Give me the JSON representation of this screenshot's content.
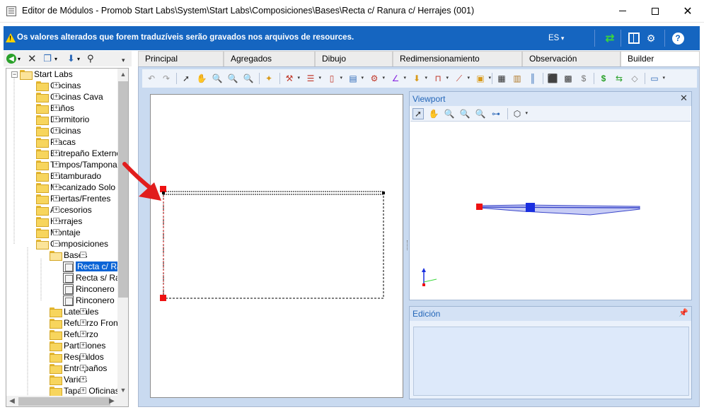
{
  "window": {
    "title": "Editor de Módulos - Promob Start Labs\\System\\Start Labs\\Composiciones\\Bases\\Recta c/ Ranura c/ Herrajes (001)",
    "minimize": "",
    "maximize": "",
    "close": "✕"
  },
  "infobar": {
    "message": "Os valores alterados que forem traduzíveis serão gravados nos arquivos de resources.",
    "language": "ES"
  },
  "tree": {
    "root": "Start Labs",
    "items": [
      {
        "label": "Cocinas"
      },
      {
        "label": "Cocinas Cava"
      },
      {
        "label": "Baños"
      },
      {
        "label": "Dormitorio"
      },
      {
        "label": "Oficinas"
      },
      {
        "label": "Placas"
      },
      {
        "label": "Entrepaño Externo"
      },
      {
        "label": "Tampos/Tamponado"
      },
      {
        "label": "Entamburado"
      },
      {
        "label": "Mecanizado Solo"
      },
      {
        "label": "Puertas/Frentes"
      },
      {
        "label": "Accesorios"
      },
      {
        "label": "Herrajes"
      },
      {
        "label": "Montaje"
      },
      {
        "label": "Composiciones"
      }
    ],
    "bases": "Bases",
    "modules": [
      {
        "label": "Recta c/ Ra"
      },
      {
        "label": "Recta s/ Ra"
      },
      {
        "label": "Rinconero L"
      },
      {
        "label": "Rinconero L"
      }
    ],
    "children": [
      {
        "label": "Laterales"
      },
      {
        "label": "Refuerzo Fronta"
      },
      {
        "label": "Refuerzo"
      },
      {
        "label": "Particiones"
      },
      {
        "label": "Respaldos"
      },
      {
        "label": "Entrepaños"
      },
      {
        "label": "Varios"
      },
      {
        "label": "Tapas Oficinas"
      }
    ]
  },
  "tabs": [
    {
      "label": "Principal"
    },
    {
      "label": "Agregados"
    },
    {
      "label": "Dibujo"
    },
    {
      "label": "Redimensionamiento"
    },
    {
      "label": "Observación"
    },
    {
      "label": "Builder"
    }
  ],
  "viewport": {
    "title": "Viewport",
    "close": "✕"
  },
  "edicion": {
    "title": "Edición"
  },
  "colors": {
    "infobar": "#1565c0",
    "accent": "#0a64d6",
    "handle": "#ee1111",
    "arrow": "#e11d1d",
    "panel_header_text": "#2366b8"
  },
  "icons": [
    "app-icon",
    "warning-icon",
    "refresh-icon",
    "panel-icon",
    "gears-icon",
    "help-icon",
    "back-icon",
    "delete-icon",
    "copy-icon",
    "binoculars-icon",
    "undo-icon",
    "redo-icon",
    "pointer-icon",
    "hand-icon",
    "zoom-icon",
    "cube-icon",
    "money-icon"
  ]
}
